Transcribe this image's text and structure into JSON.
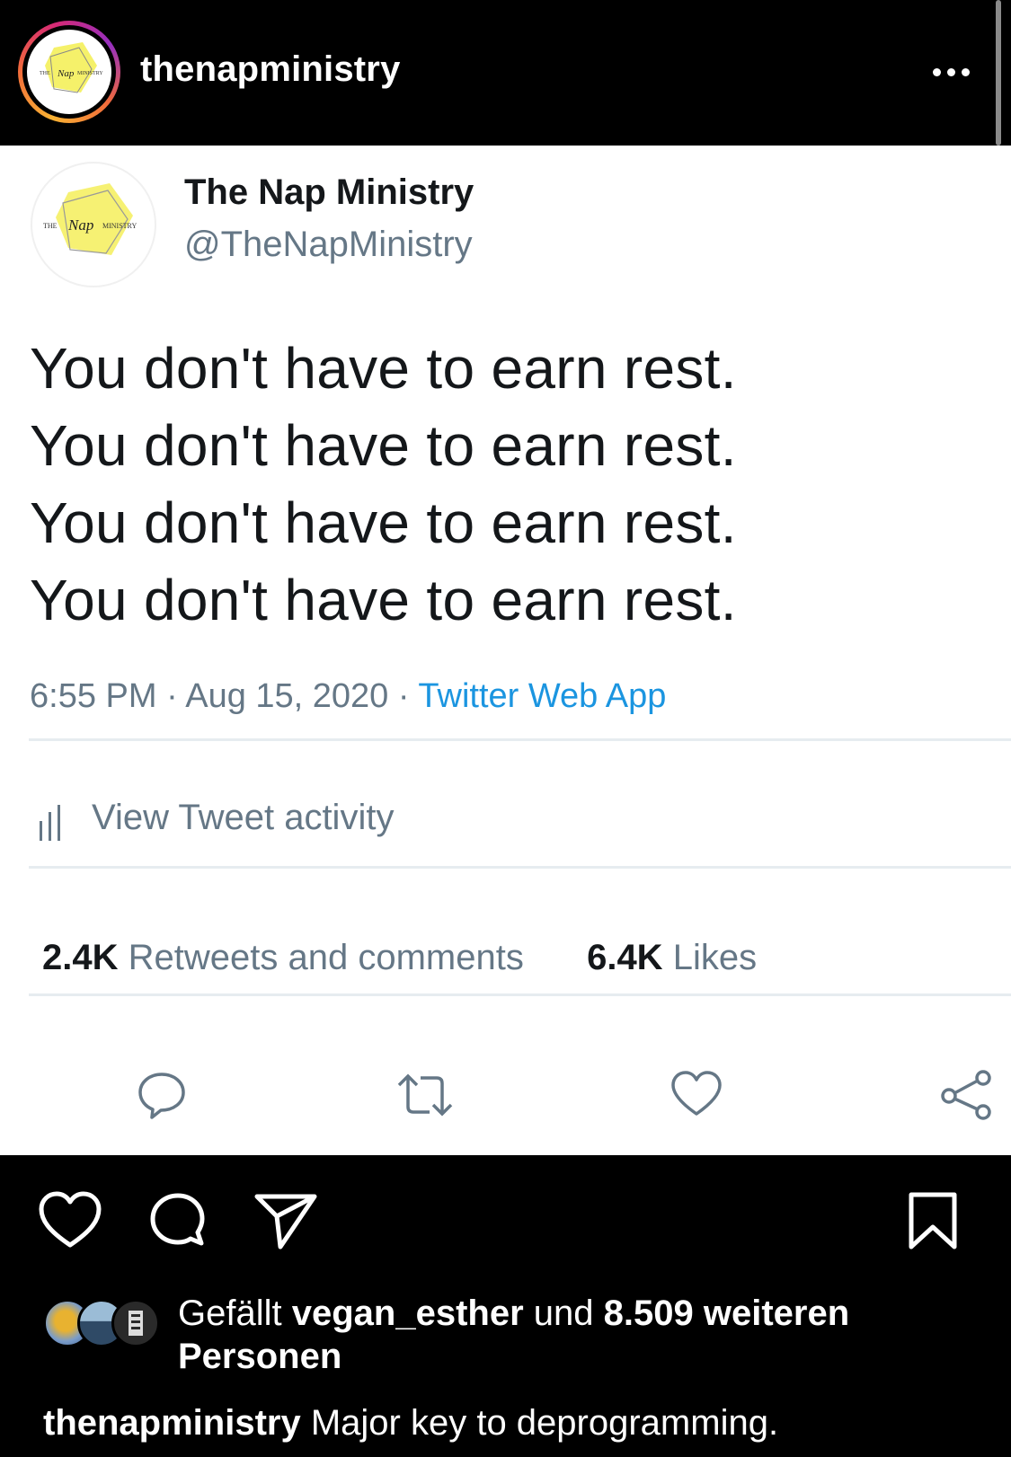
{
  "post": {
    "username": "thenapministry",
    "more_icon": "more-horizontal-icon"
  },
  "tweet": {
    "display_name": "The Nap Ministry",
    "handle": "@TheNapMinistry",
    "logo_text": {
      "the": "THE",
      "script": "Nap",
      "ministry": "MINISTRY"
    },
    "lines": [
      "You don't have to earn rest.",
      "You don't have to earn rest.",
      "You don't have to earn rest.",
      "You don't have to earn rest."
    ],
    "time": "6:55 PM",
    "separator": " · ",
    "date": "Aug 15, 2020",
    "source": "Twitter Web App",
    "activity_label": "View Tweet activity",
    "retweets_count": "2.4K",
    "retweets_label": "Retweets and comments",
    "likes_count": "6.4K",
    "likes_label": "Likes",
    "colors": {
      "link": "#1b95e0",
      "muted": "#657786",
      "text": "#14171a",
      "logo_yellow": "#f4ef5a"
    }
  },
  "likes": {
    "prefix": "Gefällt",
    "user": "vegan_esther",
    "middle": "und",
    "count_text": "8.509 weiteren",
    "suffix": "Personen"
  },
  "caption": {
    "username": "thenapministry",
    "text": "Major key to deprogramming."
  }
}
